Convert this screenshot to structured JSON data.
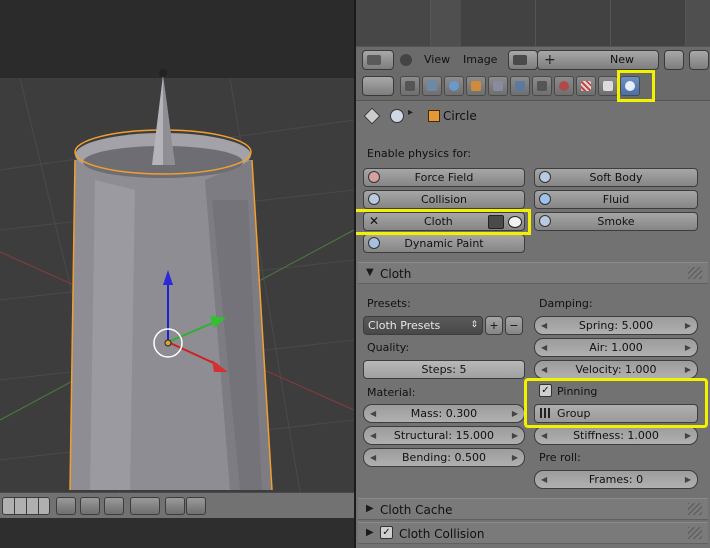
{
  "header": {
    "menus": [
      "View",
      "Image"
    ],
    "new_label": "New"
  },
  "breadcrumb": {
    "object_name": "Circle"
  },
  "physics": {
    "enable_label": "Enable physics for:",
    "buttons": {
      "force_field": "Force Field",
      "soft_body": "Soft Body",
      "collision": "Collision",
      "fluid": "Fluid",
      "cloth": "Cloth",
      "smoke": "Smoke",
      "dynamic_paint": "Dynamic Paint"
    }
  },
  "cloth": {
    "title": "Cloth",
    "presets_label": "Presets:",
    "preset_value": "Cloth Presets",
    "damping_label": "Damping:",
    "spring": "Spring: 5.000",
    "air": "Air: 1.000",
    "velocity": "Velocity: 1.000",
    "quality_label": "Quality:",
    "steps": "Steps: 5",
    "material_label": "Material:",
    "mass": "Mass: 0.300",
    "structural": "Structural: 15.000",
    "bending": "Bending: 0.500",
    "pinning_label": "Pinning",
    "group_label": "Group",
    "stiffness": "Stiffness: 1.000",
    "preroll_label": "Pre roll:",
    "frames": "Frames: 0"
  },
  "sections": {
    "cloth_cache": "Cloth Cache",
    "cloth_collision": "Cloth Collision"
  },
  "colors": {
    "highlight": "#f2f200",
    "selection_outline": "#f0a030",
    "panel_bg": "#727272"
  },
  "icons": [
    "pin-icon",
    "camera-icon",
    "eye-icon",
    "physics-tab-icon",
    "cube-icon"
  ]
}
